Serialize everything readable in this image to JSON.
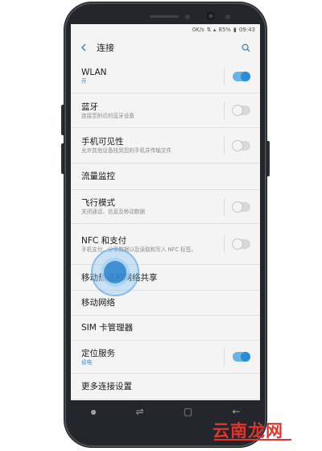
{
  "status_bar": {
    "speed": "0K/s",
    "battery": "85%",
    "time": "09:43"
  },
  "app_bar": {
    "title": "连接"
  },
  "items": [
    {
      "title": "WLAN",
      "subtitle": "开",
      "subtitle_color": "blue",
      "toggle": "on"
    },
    {
      "title": "蓝牙",
      "subtitle": "连接至附近的蓝牙设备",
      "toggle": "off"
    },
    {
      "title": "手机可见性",
      "subtitle": "允许其他设备找到您的手机并传输文件",
      "toggle": "off"
    },
    {
      "title": "流量监控"
    },
    {
      "title": "飞行模式",
      "subtitle": "关闭通话、信息及移动数据",
      "toggle": "off"
    },
    {
      "title": "NFC 和支付",
      "subtitle": "手机支付、分享数据以及读取和写入 NFC 标签。",
      "toggle": "off"
    },
    {
      "title": "移动热点和网络共享"
    },
    {
      "title": "移动网络"
    },
    {
      "title": "SIM 卡管理器"
    },
    {
      "title": "定位服务",
      "subtitle": "省电",
      "subtitle_color": "blue",
      "toggle": "on"
    },
    {
      "title": "更多连接设置"
    }
  ],
  "watermark": "云南龙网",
  "colors": {
    "accent": "#2a8dd8",
    "toggle_on_track": "#64b5e8",
    "watermark": "#e3342b"
  },
  "icons": {
    "back": "chevron-left-icon",
    "search": "search-icon"
  }
}
